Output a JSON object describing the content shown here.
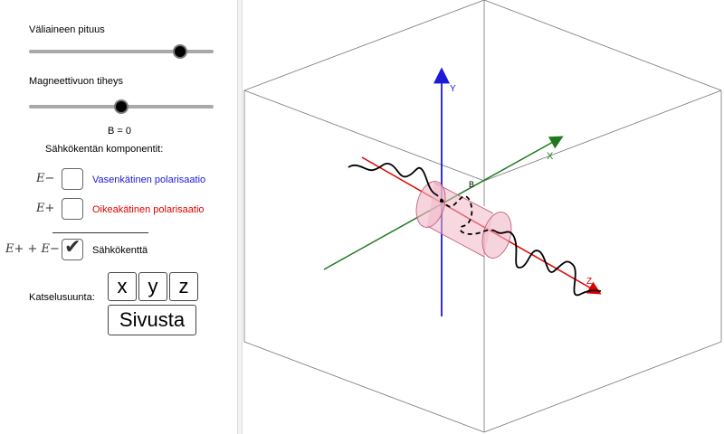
{
  "sliders": {
    "length_label": "Väliaineen pituus",
    "length_value": 0.82,
    "density_label": "Magneettivuon tiheys",
    "density_value": 0.5,
    "b_readout": "B = 0"
  },
  "components": {
    "title": "Sähkökentän komponentit:",
    "e_minus_symbol": "E−",
    "e_minus_label": "Vasenkätinen polarisaatio",
    "e_minus_checked": false,
    "e_plus_symbol": "E+",
    "e_plus_label": "Oikeakätinen polarisaatio",
    "e_plus_checked": false,
    "sum_symbol": "E+ + E−",
    "sum_label": "Sähkökenttä",
    "sum_checked": true
  },
  "view_direction": {
    "label": "Katselusuunta:",
    "x_button": "x",
    "y_button": "y",
    "z_button": "z",
    "side_button": "Sivusta"
  },
  "scene": {
    "axis_y_label": "Y",
    "axis_x_label": "X",
    "axis_z_label": "Z",
    "point_label": "B"
  },
  "colors": {
    "left_polarization": "#1a1ad8",
    "right_polarization": "#e00000",
    "axis_x": "#1f7a1f",
    "axis_y": "#1a1ad8",
    "axis_z": "#e00000"
  }
}
